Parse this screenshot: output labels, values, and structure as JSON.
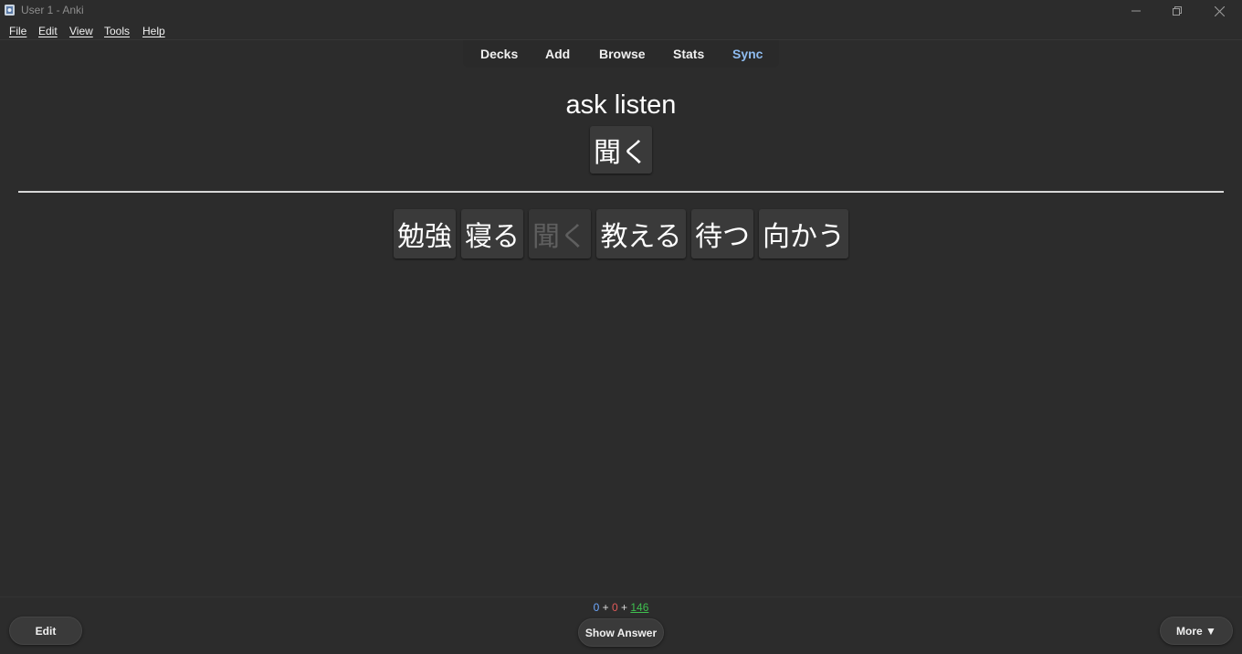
{
  "window": {
    "title": "User 1 - Anki",
    "icon": "anki-app-icon",
    "controls": [
      "minimize-icon",
      "restore-icon",
      "close-icon"
    ]
  },
  "menu": {
    "items": [
      "File",
      "Edit",
      "View",
      "Tools",
      "Help"
    ]
  },
  "toolbar": {
    "decks": "Decks",
    "add": "Add",
    "browse": "Browse",
    "stats": "Stats",
    "sync": "Sync",
    "sync_color": "#8fbcf0"
  },
  "card": {
    "prompt": "ask listen",
    "question_kanji": "聞く",
    "choices": [
      {
        "text": "勉強",
        "dimmed": false
      },
      {
        "text": "寝る",
        "dimmed": false
      },
      {
        "text": "聞く",
        "dimmed": true
      },
      {
        "text": "教える",
        "dimmed": false
      },
      {
        "text": "待つ",
        "dimmed": false
      },
      {
        "text": "向かう",
        "dimmed": false
      }
    ]
  },
  "footer": {
    "edit_label": "Edit",
    "show_answer_label": "Show Answer",
    "more_label": "More ▼",
    "counts": {
      "new": "0",
      "learn": "0",
      "review": "146",
      "sep": "+",
      "new_color": "#6ea8fe",
      "learn_color": "#e15a5a",
      "review_color": "#3fbf4f"
    }
  }
}
